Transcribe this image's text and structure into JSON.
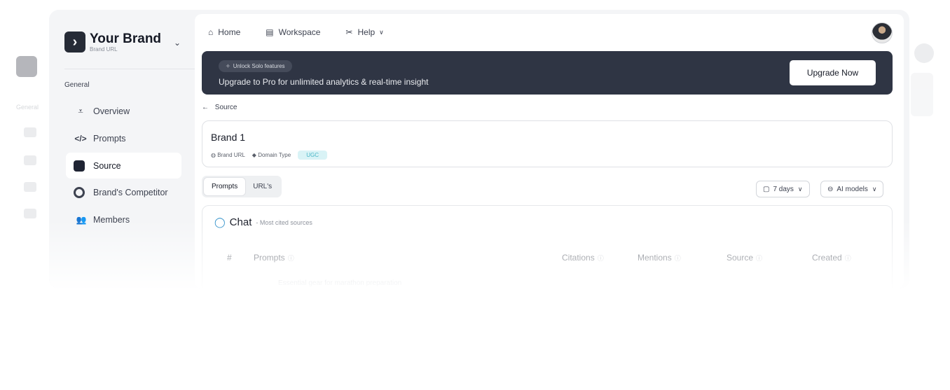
{
  "sidebar": {
    "brand_name": "Your Brand",
    "brand_url": "Brand URL",
    "brand_chevron": "⌄",
    "section_label": "General",
    "items": [
      {
        "label": "Overview",
        "icon": "chart-line-icon",
        "glyph": "⩡"
      },
      {
        "label": "Prompts",
        "icon": "code-icon",
        "glyph": "</>"
      },
      {
        "label": "Source",
        "icon": "database-icon",
        "glyph": ""
      },
      {
        "label": "Brand's Competitor",
        "icon": "competitor-icon",
        "glyph": ""
      },
      {
        "label": "Members",
        "icon": "members-icon",
        "glyph": "👥"
      }
    ],
    "active_item": "Source"
  },
  "topnav": {
    "home": "Home",
    "workspace": "Workspace",
    "help": "Help",
    "help_chevron": "∨",
    "home_glyph": "⌂",
    "workspace_glyph": "▤",
    "help_glyph": "✂"
  },
  "banner": {
    "pill_label": "Unlock Solo features",
    "pill_glyph": "✧",
    "text": "Upgrade to Pro for unlimited analytics & real-time insight",
    "button_label": "Upgrade Now"
  },
  "breadcrumb": {
    "arrow": "←",
    "label": "Source"
  },
  "brand_card": {
    "name": "Brand 1",
    "url_label": "Brand URL",
    "domain_type_label": "Domain Type",
    "domain_type_value": "UGC",
    "url_glyph": "◍",
    "tag_glyph": "◆"
  },
  "tabs": {
    "prompts": "Prompts",
    "urls": "URL's",
    "active": "Prompts"
  },
  "filters": {
    "days": "7 days",
    "models": "AI models",
    "chevron": "∨",
    "calendar_glyph": "▢",
    "model_glyph": "⊖"
  },
  "chat": {
    "icon_glyph": "◯",
    "title": "Chat",
    "subtitle": "- Most cited sources",
    "columns": {
      "index": "#",
      "prompts": "Prompts",
      "citations": "Citations",
      "mentions": "Mentions",
      "source": "Source",
      "created": "Created",
      "info_glyph": "ⓘ"
    },
    "first_row_prompt": "Essential gear for marathon preparation"
  },
  "colors": {
    "banner_bg": "#2f3544",
    "accent_chat": "#2d8fc9",
    "ugc_badge_bg": "#d9f3f6",
    "ugc_badge_text": "#48b6c7"
  }
}
